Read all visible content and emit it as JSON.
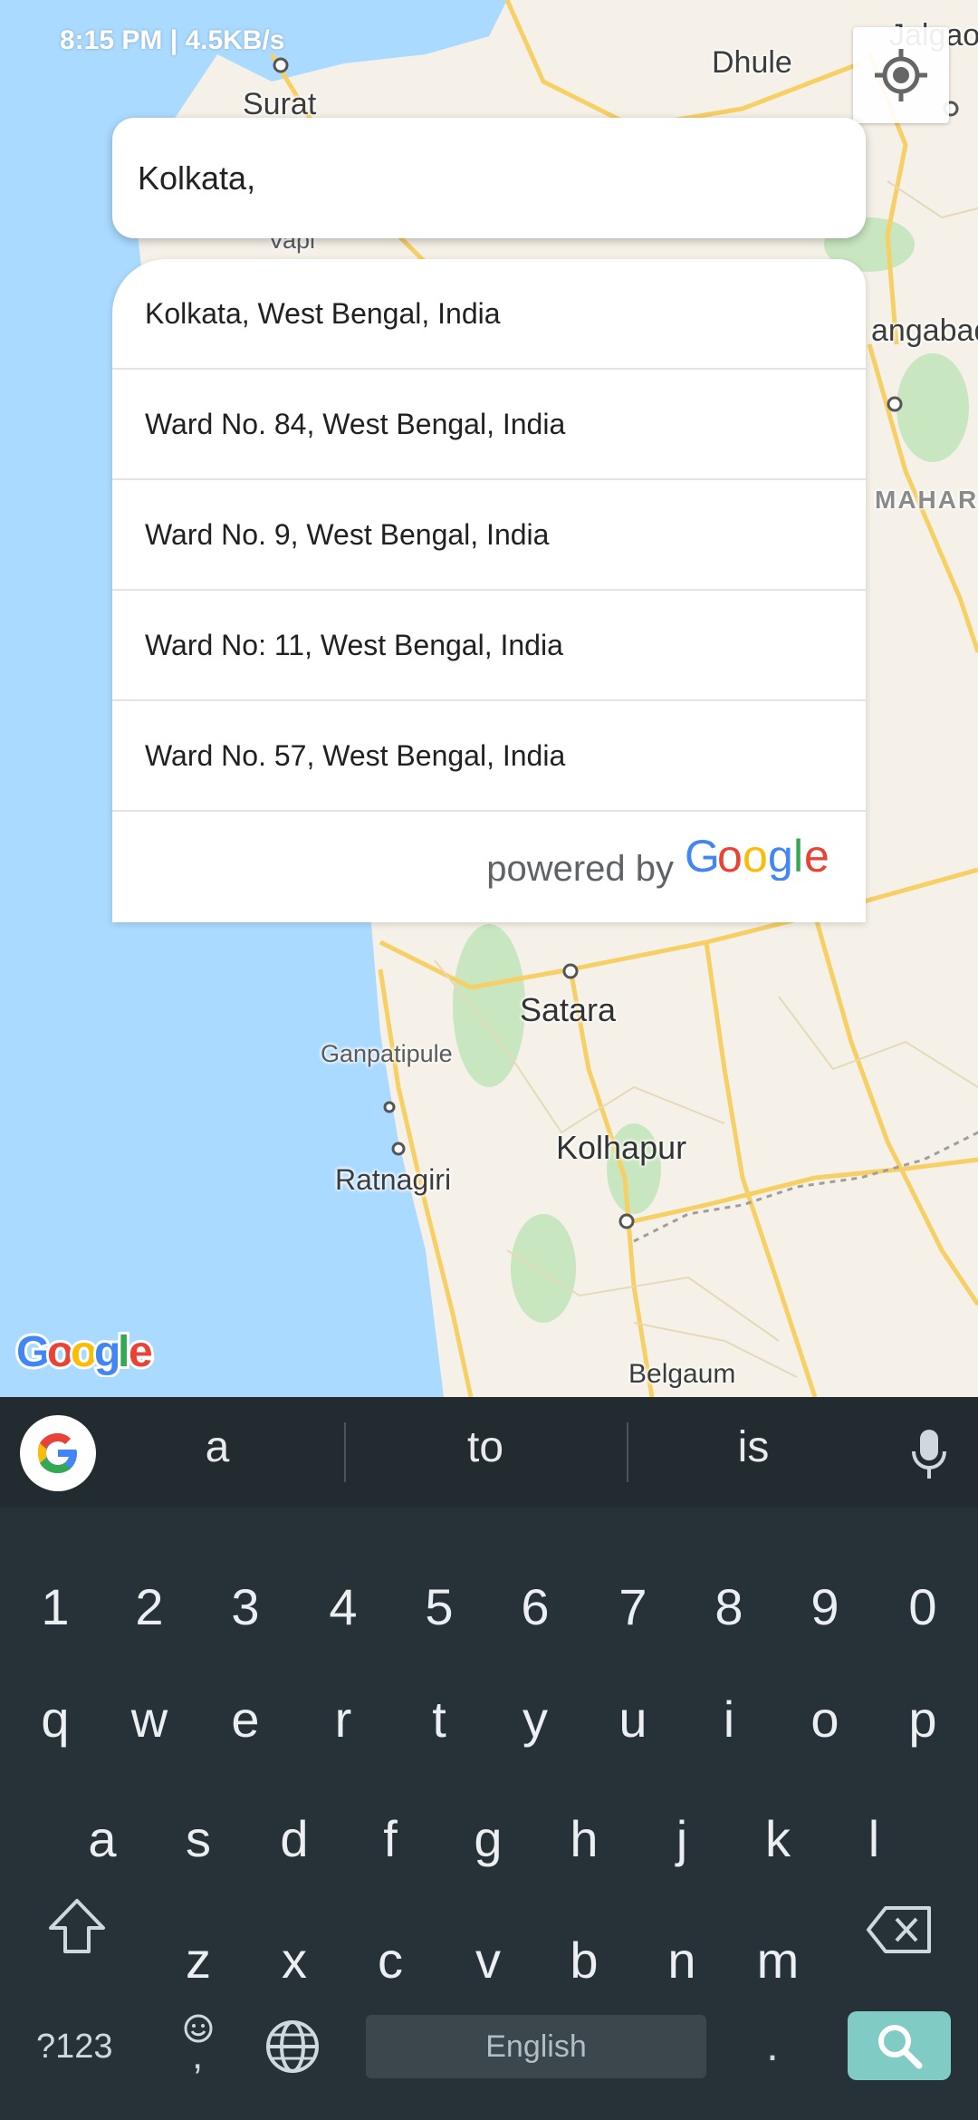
{
  "status_bar": {
    "time": "8:15 PM | 4.5KB/s"
  },
  "map": {
    "labels": {
      "surat": "Surat",
      "dhule": "Dhule",
      "jalgaon": "Jalgao",
      "vapi": "Vapi",
      "aurangabad": "angabad",
      "maharashtra": "MAHARA",
      "satara": "Satara",
      "ganpatipule": "Ganpatipule",
      "ratnagiri": "Ratnagiri",
      "kolhapur": "Kolhapur",
      "belgaum": "Belgaum"
    },
    "watermark": "Google",
    "colors": {
      "water": "#aadaff",
      "land": "#f5f1e8",
      "road": "#f6cf65",
      "park": "#c8e6c0"
    }
  },
  "search": {
    "value": "Kolkata,"
  },
  "suggestions": [
    {
      "label": "Kolkata, West Bengal, India"
    },
    {
      "label": "Ward No. 84, West Bengal, India"
    },
    {
      "label": "Ward No. 9, West Bengal, India"
    },
    {
      "label": "Ward No: 11, West Bengal, India"
    },
    {
      "label": "Ward No. 57, West Bengal, India"
    }
  ],
  "powered_by": {
    "text": "powered by",
    "brand": "Google"
  },
  "keyboard": {
    "word_suggestions": [
      "a",
      "to",
      "is"
    ],
    "number_row": [
      "1",
      "2",
      "3",
      "4",
      "5",
      "6",
      "7",
      "8",
      "9",
      "0"
    ],
    "row1": [
      "q",
      "w",
      "e",
      "r",
      "t",
      "y",
      "u",
      "i",
      "o",
      "p"
    ],
    "row2": [
      "a",
      "s",
      "d",
      "f",
      "g",
      "h",
      "j",
      "k",
      "l"
    ],
    "row3": [
      "z",
      "x",
      "c",
      "v",
      "b",
      "n",
      "m"
    ],
    "symbols_label": "?123",
    "emoji_comma": ",",
    "space_label": "English",
    "period_label": ".",
    "accent": "#80cbc4"
  }
}
